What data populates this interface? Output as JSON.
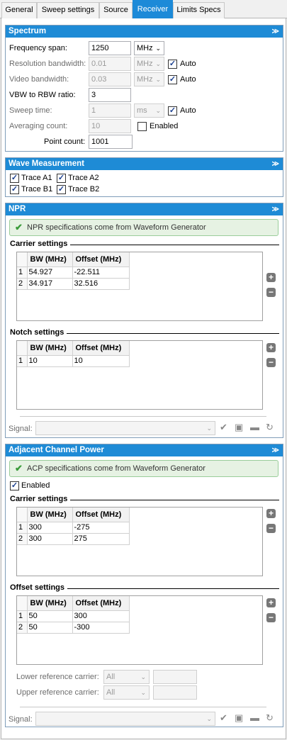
{
  "tabs": [
    "General",
    "Sweep settings",
    "Source",
    "Receiver",
    "Limits Specs"
  ],
  "spectrum": {
    "title": "Spectrum",
    "frequency_span_label": "Frequency span:",
    "frequency_span_value": "1250",
    "frequency_span_unit": "MHz",
    "rbw_label": "Resolution bandwidth:",
    "rbw_value": "0.01",
    "rbw_unit": "MHz",
    "vbw_label": "Video bandwidth:",
    "vbw_value": "0.03",
    "vbw_unit": "MHz",
    "auto_label": "Auto",
    "ratio_label": "VBW to RBW ratio:",
    "ratio_value": "3",
    "sweep_time_label": "Sweep time:",
    "sweep_time_value": "1",
    "sweep_time_unit": "ms",
    "avg_label": "Averaging count:",
    "avg_value": "10",
    "enabled_label": "Enabled",
    "point_count_label": "Point count:",
    "point_count_value": "1001"
  },
  "wave": {
    "title": "Wave Measurement",
    "traces": [
      "Trace A1",
      "Trace A2",
      "Trace B1",
      "Trace B2"
    ]
  },
  "npr": {
    "title": "NPR",
    "banner": "NPR specifications come from Waveform Generator",
    "carrier_title": "Carrier settings",
    "headers": [
      "BW (MHz)",
      "Offset (MHz)"
    ],
    "carrier_rows": [
      [
        "1",
        "54.927",
        "-22.511"
      ],
      [
        "2",
        "34.917",
        "32.516"
      ]
    ],
    "notch_title": "Notch settings",
    "notch_rows": [
      [
        "1",
        "10",
        "10"
      ]
    ],
    "signal_label": "Signal:"
  },
  "acp": {
    "title": "Adjacent Channel Power",
    "banner": "ACP specifications come from Waveform Generator",
    "enabled_label": "Enabled",
    "carrier_title": "Carrier settings",
    "headers": [
      "BW (MHz)",
      "Offset (MHz)"
    ],
    "carrier_rows": [
      [
        "1",
        "300",
        "-275"
      ],
      [
        "2",
        "300",
        "275"
      ]
    ],
    "offset_title": "Offset settings",
    "offset_rows": [
      [
        "1",
        "50",
        "300"
      ],
      [
        "2",
        "50",
        "-300"
      ]
    ],
    "lower_ref_label": "Lower reference carrier:",
    "upper_ref_label": "Upper reference carrier:",
    "ref_value": "All",
    "signal_label": "Signal:"
  }
}
